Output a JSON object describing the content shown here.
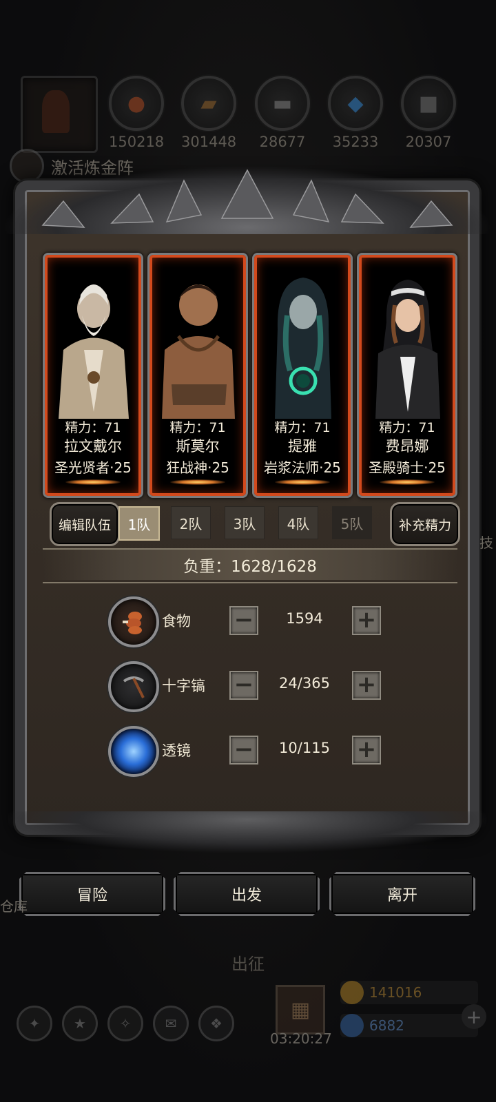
{
  "resources": [
    {
      "icon": "meat-icon",
      "value": "150218"
    },
    {
      "icon": "wood-icon",
      "value": "301448"
    },
    {
      "icon": "iron-icon",
      "value": "28677"
    },
    {
      "icon": "crystal-icon",
      "value": "35233"
    },
    {
      "icon": "stone-icon",
      "value": "20307"
    }
  ],
  "alchemy_label": "激活炼金阵",
  "heroes": [
    {
      "stamina": "精力：71",
      "name": "拉文戴尔",
      "class": "圣光贤者·25"
    },
    {
      "stamina": "精力：71",
      "name": "斯莫尔",
      "class": "狂战神·25"
    },
    {
      "stamina": "精力：71",
      "name": "提雅",
      "class": "岩浆法师·25"
    },
    {
      "stamina": "精力：71",
      "name": "费昂娜",
      "class": "圣殿骑士·25"
    }
  ],
  "team": {
    "edit_label": "编辑队伍",
    "refill_label": "补充精力",
    "tabs": [
      "1队",
      "2队",
      "3队",
      "4队",
      "5队"
    ],
    "active_index": 0
  },
  "weight": "负重：1628/1628",
  "supplies": [
    {
      "icon": "food-icon",
      "label": "食物",
      "value": "1594"
    },
    {
      "icon": "pickaxe-icon",
      "label": "十字镐",
      "value": "24/365"
    },
    {
      "icon": "lens-icon",
      "label": "透镜",
      "value": "10/115"
    }
  ],
  "actions": {
    "adventure": "冒险",
    "depart": "出发",
    "leave": "离开"
  },
  "background": {
    "depart_title": "出征",
    "timer": "03:20:27",
    "gold": "141016",
    "gems": "6882",
    "side_left": "仓库",
    "side_right": "技"
  },
  "colors": {
    "accent_orange": "#d2491c",
    "frame": "#3a3a3c",
    "parchment": "#3d342b"
  }
}
